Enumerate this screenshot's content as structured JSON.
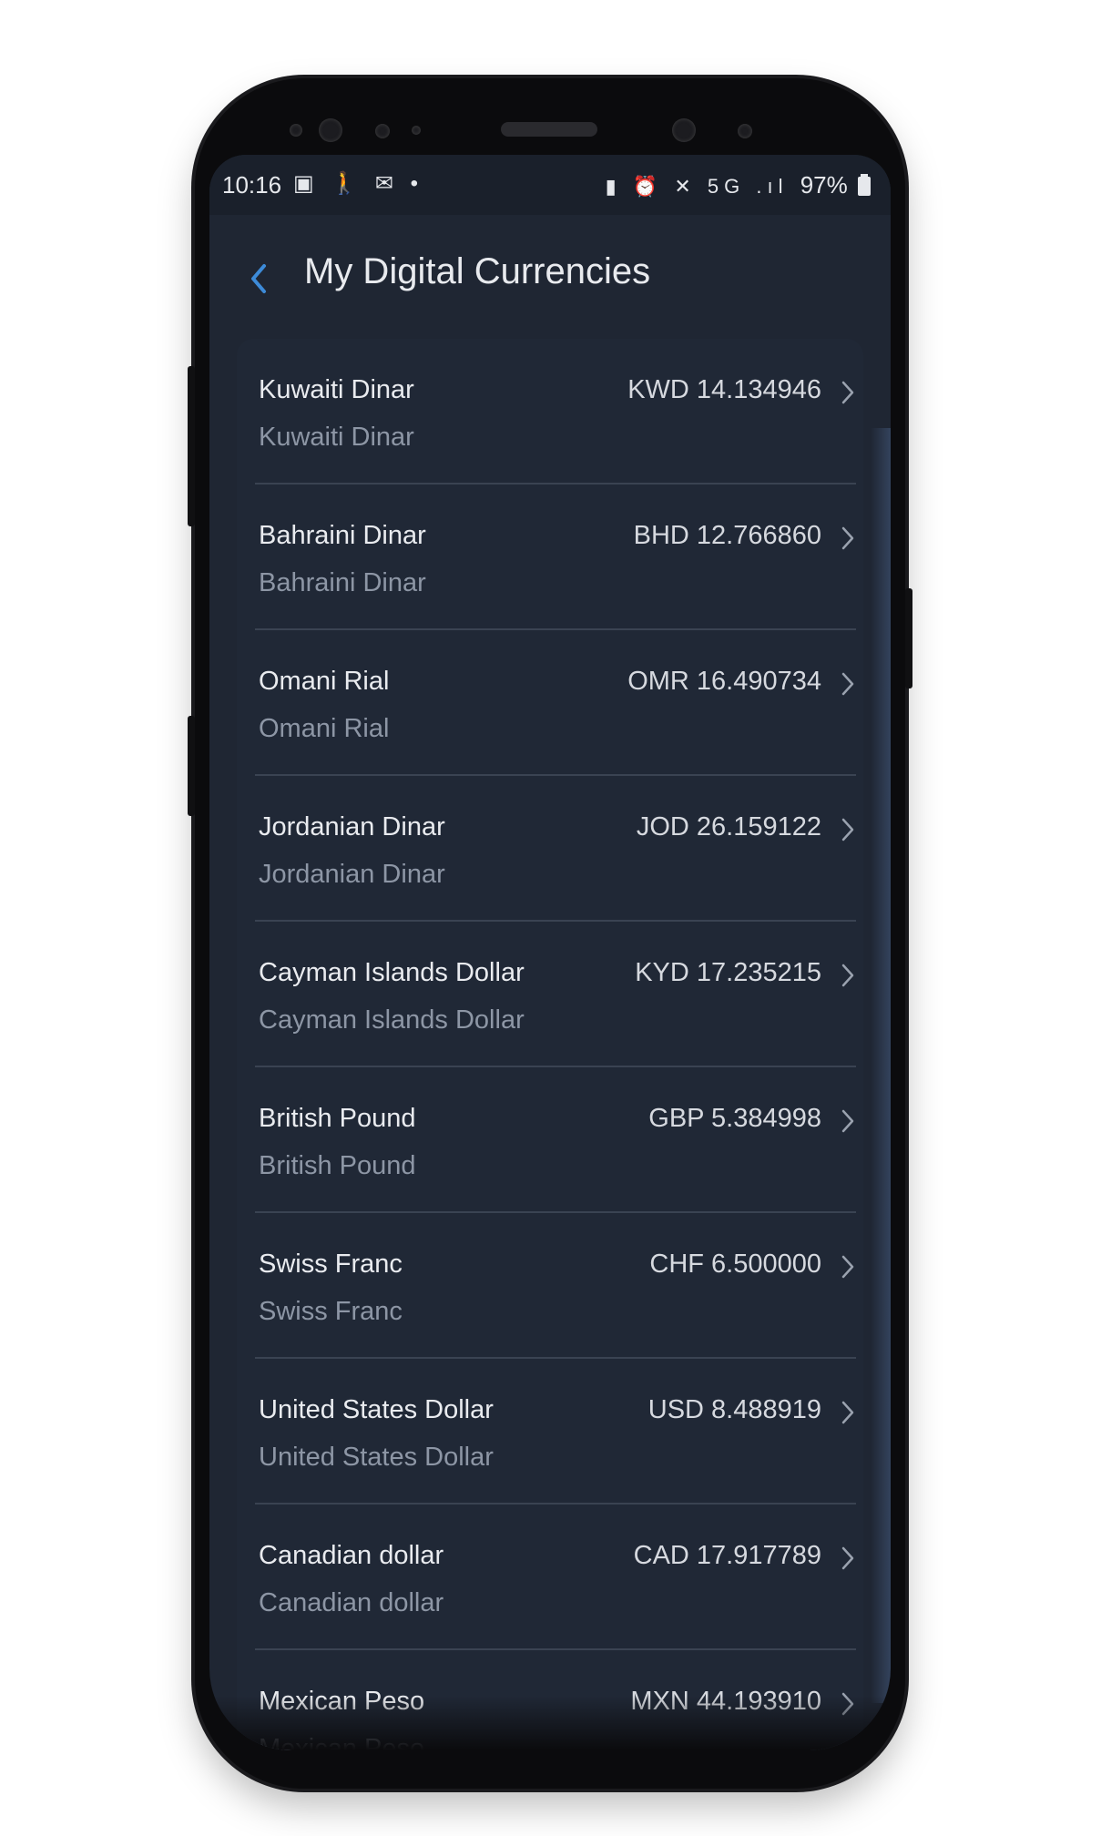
{
  "status_bar": {
    "time": "10:16",
    "left_icons": [
      "image-icon",
      "walking-icon",
      "card-icon",
      "dot-icon"
    ],
    "left_icons_text": "▣ 🚶 ✉ •",
    "right_icons": [
      "battery-saver-icon",
      "alarm-icon",
      "mute-icon",
      "5g-icon",
      "signal-icon"
    ],
    "right_icons_text": "▮ ⏰ ✕ 5G .ıl",
    "battery": "97%"
  },
  "app_bar": {
    "title": "My Digital Currencies",
    "back_icon": "chevron-left-icon"
  },
  "currencies": [
    {
      "name": "Kuwaiti Dinar",
      "subtitle": "Kuwaiti Dinar",
      "amount": "KWD 14.134946"
    },
    {
      "name": "Bahraini Dinar",
      "subtitle": "Bahraini Dinar",
      "amount": "BHD 12.766860"
    },
    {
      "name": "Omani Rial",
      "subtitle": "Omani Rial",
      "amount": "OMR 16.490734"
    },
    {
      "name": "Jordanian Dinar",
      "subtitle": "Jordanian Dinar",
      "amount": "JOD 26.159122"
    },
    {
      "name": "Cayman Islands Dollar",
      "subtitle": "Cayman Islands Dollar",
      "amount": "KYD 17.235215"
    },
    {
      "name": "British Pound",
      "subtitle": "British Pound",
      "amount": "GBP 5.384998"
    },
    {
      "name": "Swiss Franc",
      "subtitle": "Swiss Franc",
      "amount": "CHF 6.500000"
    },
    {
      "name": "United States Dollar",
      "subtitle": "United States Dollar",
      "amount": "USD 8.488919"
    },
    {
      "name": "Canadian dollar",
      "subtitle": "Canadian dollar",
      "amount": "CAD 17.917789"
    },
    {
      "name": "Mexican Peso",
      "subtitle": "Mexican Peso",
      "amount": "MXN 44.193910"
    }
  ],
  "colors": {
    "screen_bg": "#1f2633",
    "card_bg": "#202836",
    "accent": "#3d8bd9",
    "text_primary": "#e9ebef",
    "text_secondary": "#8d96a5"
  }
}
